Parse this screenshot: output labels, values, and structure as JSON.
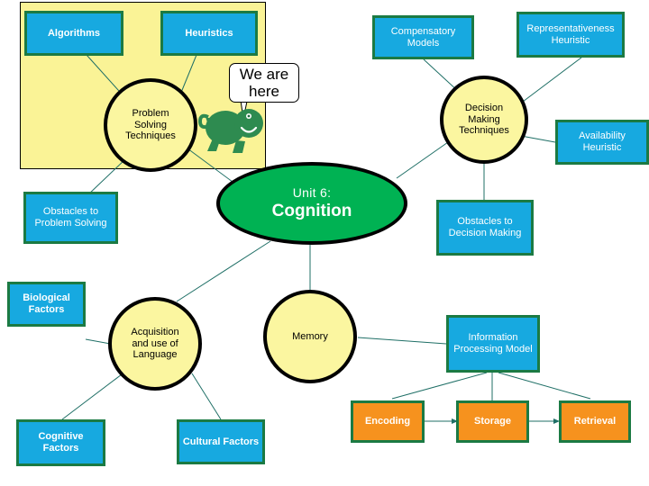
{
  "diagram": {
    "title_node": {
      "unit_label": "Unit 6:",
      "title": "Cognition"
    },
    "callout": {
      "text": "We are here",
      "icon": "turtle-mascot"
    },
    "highlight_region": {
      "color": "#faf396",
      "label": "problem-solving-highlight"
    },
    "colors": {
      "blue_box": "#17a9e0",
      "orange_box": "#f6921e",
      "box_border": "#1b7a43",
      "circle_fill": "#fbf6a0",
      "center_fill": "#00b253",
      "edge": "#1f6f66",
      "highlight": "#faf396"
    },
    "nodes": [
      {
        "id": "algorithms",
        "label": "Algorithms",
        "shape": "box",
        "color": "blue",
        "bold": true
      },
      {
        "id": "heuristics",
        "label": "Heuristics",
        "shape": "box",
        "color": "blue",
        "bold": true
      },
      {
        "id": "compensatory-models",
        "label": "Compensatory Models",
        "shape": "box",
        "color": "blue",
        "bold": false
      },
      {
        "id": "representativeness-heuristic",
        "label": "Representativeness Heuristic",
        "shape": "box",
        "color": "blue",
        "bold": false
      },
      {
        "id": "availability-heuristic",
        "label": "Availability Heuristic",
        "shape": "box",
        "color": "blue",
        "bold": false
      },
      {
        "id": "problem-solving-techniques",
        "label": "Problem Solving Techniques",
        "shape": "circle",
        "color": "yellow",
        "bold": false
      },
      {
        "id": "decision-making-techniques",
        "label": "Decision Making Techniques",
        "shape": "circle",
        "color": "yellow",
        "bold": false
      },
      {
        "id": "obstacles-to-problem-solving",
        "label": "Obstacles to Problem Solving",
        "shape": "box",
        "color": "blue",
        "bold": false
      },
      {
        "id": "obstacles-to-decision-making",
        "label": "Obstacles to Decision Making",
        "shape": "box",
        "color": "blue",
        "bold": false
      },
      {
        "id": "biological-factors",
        "label": "Biological Factors",
        "shape": "box",
        "color": "blue",
        "bold": true
      },
      {
        "id": "cognitive-factors",
        "label": "Cognitive Factors",
        "shape": "box",
        "color": "blue",
        "bold": true
      },
      {
        "id": "cultural-factors",
        "label": "Cultural Factors",
        "shape": "box",
        "color": "blue",
        "bold": true
      },
      {
        "id": "acquisition-and-use-of-language",
        "label": "Acquisition and use  of Language",
        "shape": "circle",
        "color": "yellow",
        "bold": false
      },
      {
        "id": "memory",
        "label": "Memory",
        "shape": "circle",
        "color": "yellow",
        "bold": false
      },
      {
        "id": "information-processing-model",
        "label": "Information Processing Model",
        "shape": "box",
        "color": "blue",
        "bold": false
      },
      {
        "id": "encoding",
        "label": "Encoding",
        "shape": "box",
        "color": "orange",
        "bold": true
      },
      {
        "id": "storage",
        "label": "Storage",
        "shape": "box",
        "color": "orange",
        "bold": true
      },
      {
        "id": "retrieval",
        "label": "Retrieval",
        "shape": "box",
        "color": "orange",
        "bold": true
      }
    ],
    "labels": {
      "algorithms": "Algorithms",
      "heuristics": "Heuristics",
      "compensatory_models": "Compensatory Models",
      "representativeness_heuristic": "Representativeness Heuristic",
      "availability_heuristic": "Availability Heuristic",
      "problem_solving_techniques_l1": "Problem",
      "problem_solving_techniques_l2": "Solving",
      "problem_solving_techniques_l3": "Techniques",
      "decision_making_techniques_l1": "Decision",
      "decision_making_techniques_l2": "Making",
      "decision_making_techniques_l3": "Techniques",
      "obstacles_to_problem_solving": "Obstacles to Problem Solving",
      "obstacles_to_decision_making": "Obstacles to Decision Making",
      "biological_factors": "Biological Factors",
      "cognitive_factors": "Cognitive Factors",
      "cultural_factors": "Cultural Factors",
      "acquisition_l1": "Acquisition",
      "acquisition_l2": "and use  of",
      "acquisition_l3": "Language",
      "memory": "Memory",
      "information_processing_model": "Information Processing Model",
      "encoding": "Encoding",
      "storage": "Storage",
      "retrieval": "Retrieval"
    },
    "edges": [
      {
        "from": "algorithms",
        "to": "problem-solving-techniques",
        "arrow": false
      },
      {
        "from": "heuristics",
        "to": "problem-solving-techniques",
        "arrow": false
      },
      {
        "from": "problem-solving-techniques",
        "to": "obstacles-to-problem-solving",
        "arrow": false
      },
      {
        "from": "problem-solving-techniques",
        "to": "cognition",
        "arrow": false
      },
      {
        "from": "compensatory-models",
        "to": "decision-making-techniques",
        "arrow": false
      },
      {
        "from": "representativeness-heuristic",
        "to": "decision-making-techniques",
        "arrow": false
      },
      {
        "from": "availability-heuristic",
        "to": "decision-making-techniques",
        "arrow": false
      },
      {
        "from": "decision-making-techniques",
        "to": "cognition",
        "arrow": false
      },
      {
        "from": "decision-making-techniques",
        "to": "obstacles-to-decision-making",
        "arrow": false
      },
      {
        "from": "cognition",
        "to": "acquisition-and-use-of-language",
        "arrow": false
      },
      {
        "from": "cognition",
        "to": "memory",
        "arrow": false
      },
      {
        "from": "acquisition-and-use-of-language",
        "to": "biological-factors",
        "arrow": false
      },
      {
        "from": "acquisition-and-use-of-language",
        "to": "cognitive-factors",
        "arrow": false
      },
      {
        "from": "acquisition-and-use-of-language",
        "to": "cultural-factors",
        "arrow": false
      },
      {
        "from": "memory",
        "to": "information-processing-model",
        "arrow": false
      },
      {
        "from": "information-processing-model",
        "to": "encoding",
        "arrow": false
      },
      {
        "from": "information-processing-model",
        "to": "storage",
        "arrow": false
      },
      {
        "from": "information-processing-model",
        "to": "retrieval",
        "arrow": false
      },
      {
        "from": "encoding",
        "to": "storage",
        "arrow": true
      },
      {
        "from": "storage",
        "to": "retrieval",
        "arrow": true
      }
    ]
  }
}
